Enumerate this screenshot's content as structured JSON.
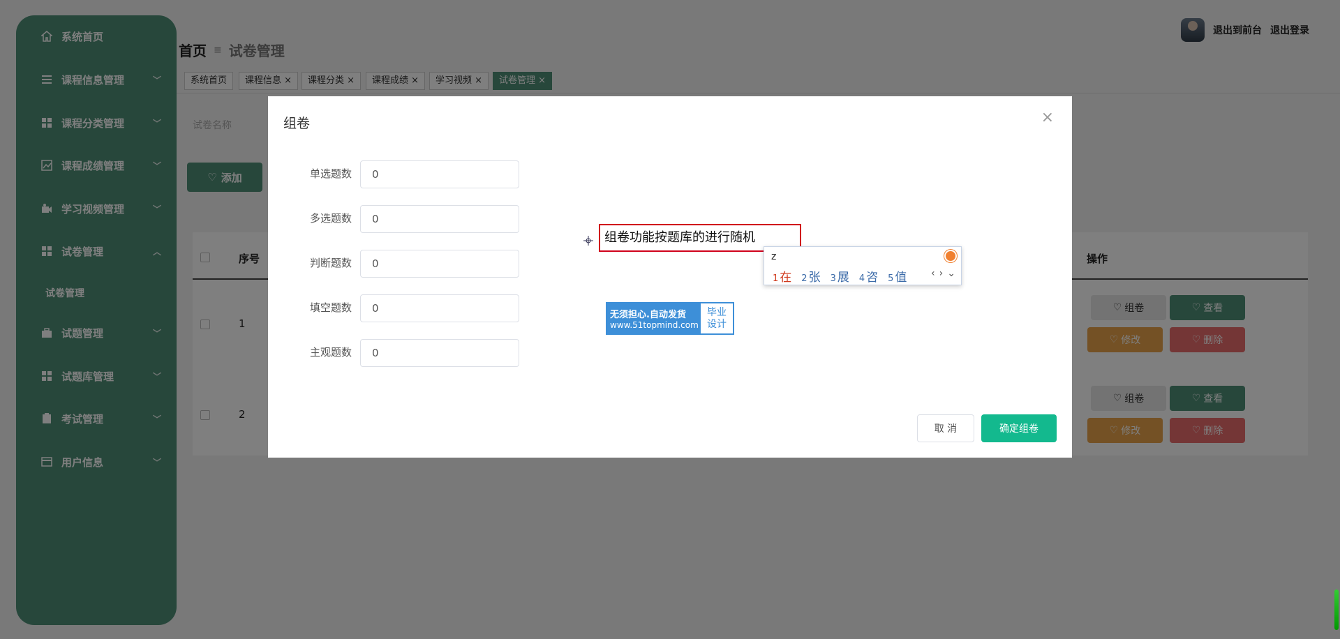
{
  "sidebar": {
    "items": [
      {
        "label": "系统首页",
        "icon": "home-icon"
      },
      {
        "label": "课程信息管理",
        "icon": "list-icon"
      },
      {
        "label": "课程分类管理",
        "icon": "grid-icon"
      },
      {
        "label": "课程成绩管理",
        "icon": "chart-icon"
      },
      {
        "label": "学习视频管理",
        "icon": "video-icon"
      },
      {
        "label": "试卷管理",
        "icon": "grid-icon"
      },
      {
        "label": "试题管理",
        "icon": "briefcase-icon"
      },
      {
        "label": "试题库管理",
        "icon": "grid-icon"
      },
      {
        "label": "考试管理",
        "icon": "clipboard-icon"
      },
      {
        "label": "用户信息",
        "icon": "card-icon"
      }
    ],
    "sub_item": "试卷管理"
  },
  "breadcrumb": {
    "home": "首页",
    "separator": "≡",
    "current": "试卷管理"
  },
  "user": {
    "to_front": "退出到前台",
    "logout": "退出登录"
  },
  "tags": [
    "系统首页",
    "课程信息",
    "课程分类",
    "课程成绩",
    "学习视频",
    "试卷管理"
  ],
  "search": {
    "placeholder": "试卷名称"
  },
  "add_button": "添加",
  "table": {
    "headers": {
      "index": "序号",
      "operations": "操作"
    },
    "rows": [
      {
        "index": "1"
      },
      {
        "index": "2"
      }
    ],
    "actions": {
      "compose": "组卷",
      "view": "查看",
      "edit": "修改",
      "delete": "删除"
    }
  },
  "modal": {
    "title": "组卷",
    "fields": [
      {
        "label": "单选题数",
        "value": "0"
      },
      {
        "label": "多选题数",
        "value": "0"
      },
      {
        "label": "判断题数",
        "value": "0"
      },
      {
        "label": "填空题数",
        "value": "0"
      },
      {
        "label": "主观题数",
        "value": "0"
      }
    ],
    "cancel": "取 消",
    "confirm": "确定组卷"
  },
  "annotation": "组卷功能按题库的进行随机",
  "ime": {
    "input": "z",
    "candidates": [
      {
        "n": "1",
        "c": "在"
      },
      {
        "n": "2",
        "c": "张"
      },
      {
        "n": "3",
        "c": "展"
      },
      {
        "n": "4",
        "c": "咨"
      },
      {
        "n": "5",
        "c": "值"
      }
    ]
  },
  "badge": {
    "line1": "无须担心.自动发货",
    "line2": "www.51topmind.com",
    "right1": "毕业",
    "right2": "设计"
  },
  "colors": {
    "sidebar": "#4f8e77",
    "confirm": "#13b98e",
    "annotation_border": "#d0021b"
  }
}
